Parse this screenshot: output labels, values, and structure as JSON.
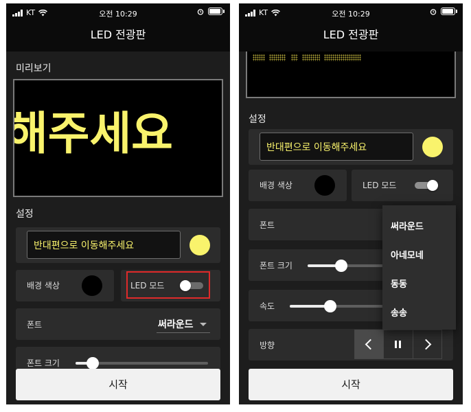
{
  "status_bar": {
    "carrier": "KT",
    "time": "오전 10:29"
  },
  "left": {
    "title": "LED 전광판",
    "preview_label": "미리보기",
    "preview_text": "해주세요",
    "settings_label": "설정",
    "message_value": "반대편으로 이동해주세요",
    "bg_color_label": "배경 색상",
    "led_mode_label": "LED 모드",
    "led_mode_on": false,
    "font_label": "폰트",
    "font_value": "써라운드",
    "font_size_label": "폰트 크기",
    "font_size_level": 0.13,
    "start_label": "시작"
  },
  "right": {
    "title": "LED 전광판",
    "settings_label": "설정",
    "message_value": "반대편으로 이동해주세요",
    "bg_color_label": "배경 색상",
    "led_mode_label": "LED 모드",
    "led_mode_on": true,
    "font_label": "폰트",
    "font_size_label": "폰트 크기",
    "font_size_level": 0.25,
    "speed_label": "속도",
    "speed_level": 0.3,
    "direction_label": "방향",
    "start_label": "시작",
    "font_options": [
      "써라운드",
      "아네모네",
      "동동",
      "송송"
    ]
  },
  "colors": {
    "text_color": "#f9f36c",
    "background_color": "#000000",
    "highlight": "#e02a2a"
  },
  "icons": [
    "signal-icon",
    "wifi-icon",
    "alarm-icon",
    "battery-icon",
    "chevron-down-icon",
    "chevron-left-icon",
    "pause-icon",
    "chevron-right-icon"
  ]
}
